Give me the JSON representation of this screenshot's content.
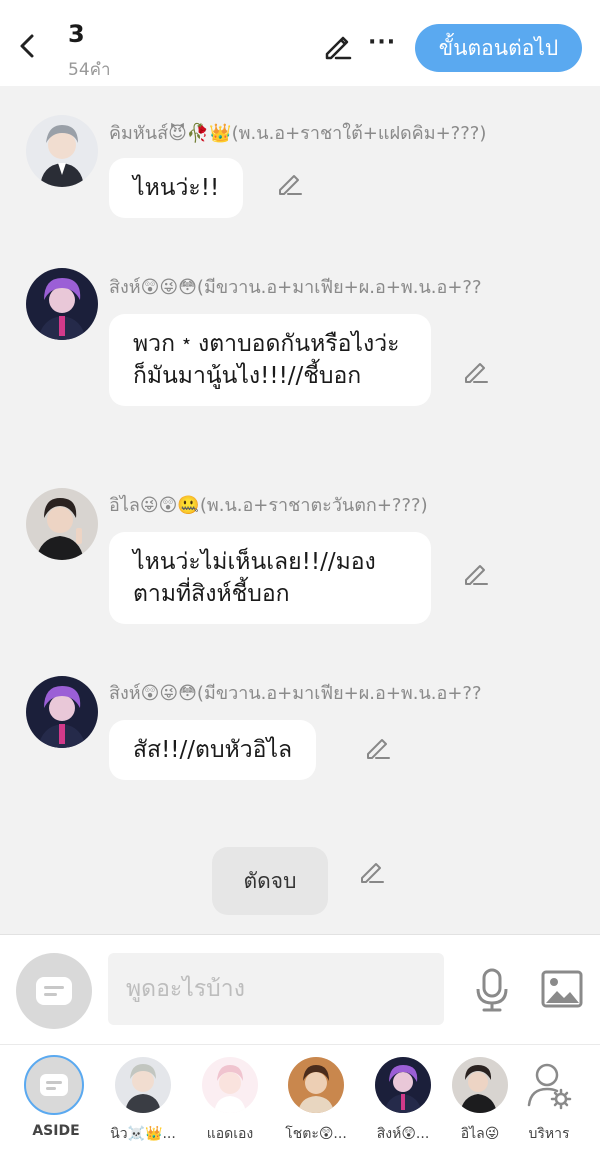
{
  "header": {
    "title": "3",
    "subtitle": "54คำ",
    "next_label": "ขั้นตอนต่อไป",
    "more_label": "···"
  },
  "messages": [
    {
      "sender": "คิมหันส์😈🥀👑(พ.น.อ+ราชาใต้+แฝดคิม+???)",
      "text": "ไหนว่ะ!!",
      "avatar": "avatar-silver-hair"
    },
    {
      "sender": "สิงห์😲😜😳(มีขวาน.อ+มาเฟีย+ผ.อ+พ.น.อ+??",
      "text": "พวก﹡งตาบอดกันหรือไงว่ะ ก็มันมานู้นไง!!!//ชี้บอก",
      "avatar": "avatar-purple-hair"
    },
    {
      "sender": "อิไล😜😲🤐(พ.น.อ+ราชาตะวันตก+???)",
      "text": "ไหนว่ะไม่เห็นเลย!!//มองตามที่สิงห์ชี้บอก",
      "avatar": "avatar-dark-hair"
    },
    {
      "sender": "สิงห์😲😜😳(มีขวาน.อ+มาเฟีย+ผ.อ+พ.น.อ+??",
      "text": "สัส!!//ตบหัวอิไล",
      "avatar": "avatar-purple-hair"
    }
  ],
  "end_label": "ตัดจบ",
  "composer": {
    "placeholder": "พูดอะไรบ้าง"
  },
  "characters": [
    {
      "name": "ASIDE",
      "icon": "chat-bubble-icon"
    },
    {
      "name": "นิว☠️👑...",
      "icon": "avatar-silver-hair"
    },
    {
      "name": "แอดเอง",
      "icon": "avatar-pink"
    },
    {
      "name": "โชตะ😲...",
      "icon": "avatar-warm"
    },
    {
      "name": "สิงห์😲...",
      "icon": "avatar-purple-hair"
    },
    {
      "name": "อิไล😜",
      "icon": "avatar-dark-hair"
    },
    {
      "name": "บริหาร",
      "icon": "user-gear-icon"
    }
  ],
  "colors": {
    "accent": "#5aa9f0",
    "background": "#f2f2f2",
    "bubble": "#ffffff"
  }
}
